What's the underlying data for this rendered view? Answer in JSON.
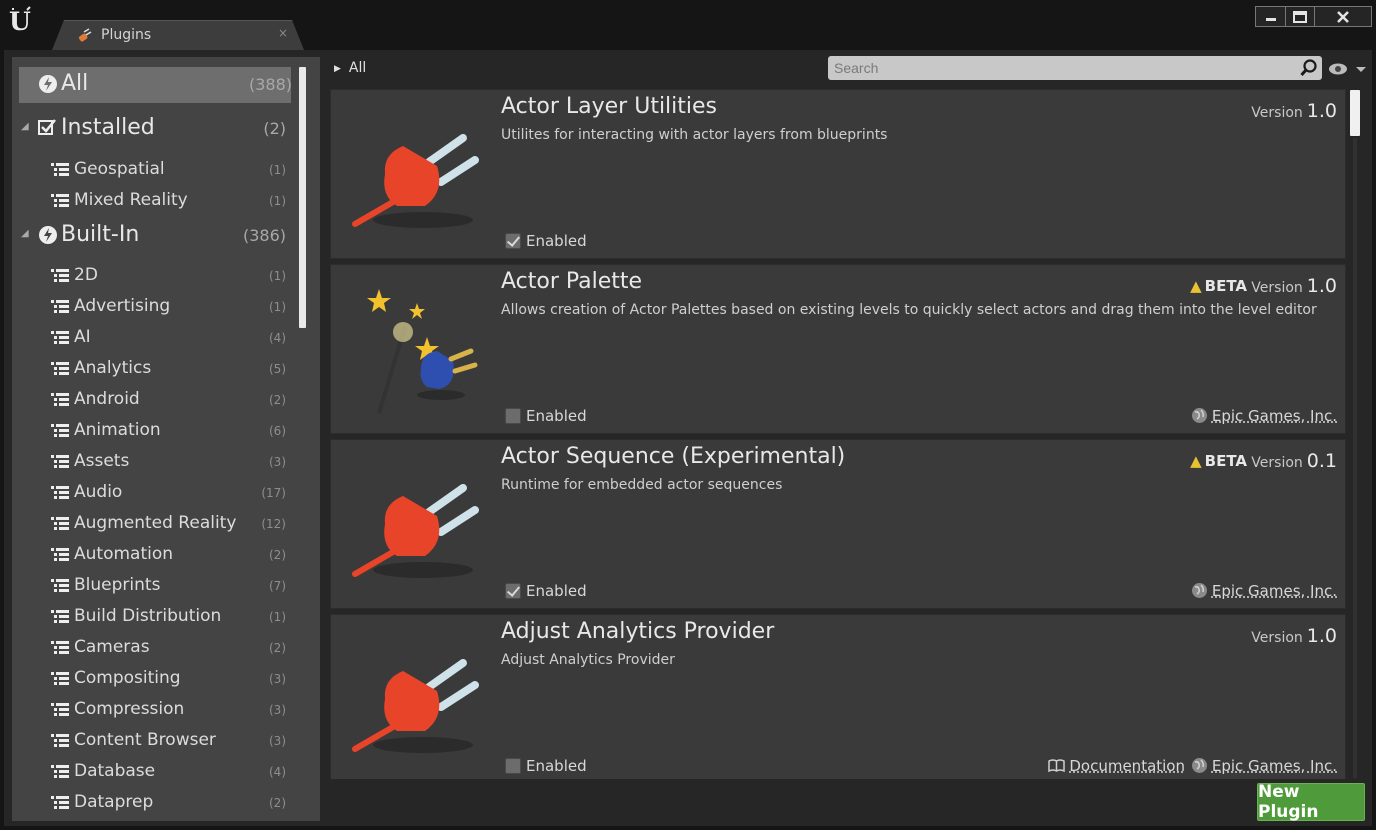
{
  "window": {
    "tab_label": "Plugins",
    "tab_close": "×",
    "minimize": "▁",
    "maximize": "❐",
    "close": "✕"
  },
  "sidebar": {
    "categories": [
      {
        "label": "All",
        "count": "(388)",
        "selected": true
      },
      {
        "label": "Installed",
        "count": "(2)",
        "children": [
          {
            "label": "Geospatial",
            "count": "(1)"
          },
          {
            "label": "Mixed Reality",
            "count": "(1)"
          }
        ]
      },
      {
        "label": "Built-In",
        "count": "(386)",
        "children": [
          {
            "label": "2D",
            "count": "(1)"
          },
          {
            "label": "Advertising",
            "count": "(1)"
          },
          {
            "label": "AI",
            "count": "(4)"
          },
          {
            "label": "Analytics",
            "count": "(5)"
          },
          {
            "label": "Android",
            "count": "(2)"
          },
          {
            "label": "Animation",
            "count": "(6)"
          },
          {
            "label": "Assets",
            "count": "(3)"
          },
          {
            "label": "Audio",
            "count": "(17)"
          },
          {
            "label": "Augmented Reality",
            "count": "(12)"
          },
          {
            "label": "Automation",
            "count": "(2)"
          },
          {
            "label": "Blueprints",
            "count": "(7)"
          },
          {
            "label": "Build Distribution",
            "count": "(1)"
          },
          {
            "label": "Cameras",
            "count": "(2)"
          },
          {
            "label": "Compositing",
            "count": "(3)"
          },
          {
            "label": "Compression",
            "count": "(3)"
          },
          {
            "label": "Content Browser",
            "count": "(3)"
          },
          {
            "label": "Database",
            "count": "(4)"
          },
          {
            "label": "Dataprep",
            "count": "(2)"
          }
        ]
      }
    ]
  },
  "main": {
    "breadcrumb": "All",
    "search": {
      "placeholder": "Search",
      "value": ""
    },
    "plugins": [
      {
        "title": "Actor Layer Utilities",
        "description": "Utilites for interacting with actor layers from blueprints",
        "beta": false,
        "version_label": "Version",
        "version": "1.0",
        "enabled": true,
        "enabled_label": "Enabled",
        "icon": "plug-icon",
        "links": []
      },
      {
        "title": "Actor Palette",
        "description": "Allows creation of Actor Palettes based on existing levels to quickly select actors and drag them into the level editor",
        "beta": true,
        "beta_label": "BETA",
        "version_label": "Version",
        "version": "1.0",
        "enabled": false,
        "enabled_label": "Enabled",
        "icon": "magic-wand-plug-icon",
        "links": [
          {
            "label": "Epic Games, Inc.",
            "icon": "globe-icon"
          }
        ]
      },
      {
        "title": "Actor Sequence (Experimental)",
        "description": "Runtime for embedded actor sequences",
        "beta": true,
        "beta_label": "BETA",
        "version_label": "Version",
        "version": "0.1",
        "enabled": true,
        "enabled_label": "Enabled",
        "icon": "plug-icon",
        "links": [
          {
            "label": "Epic Games, Inc.",
            "icon": "globe-icon"
          }
        ]
      },
      {
        "title": "Adjust Analytics Provider",
        "description": "Adjust Analytics Provider",
        "beta": false,
        "version_label": "Version",
        "version": "1.0",
        "enabled": false,
        "enabled_label": "Enabled",
        "icon": "plug-icon",
        "links": [
          {
            "label": "Documentation",
            "icon": "book-icon"
          },
          {
            "label": "Epic Games, Inc.",
            "icon": "globe-icon"
          }
        ]
      }
    ],
    "new_plugin_label": "New Plugin"
  },
  "colors": {
    "plug_red": "#e8442a",
    "beta_warning": "#e8c230",
    "new_plugin_green": "#4f9a3a"
  }
}
